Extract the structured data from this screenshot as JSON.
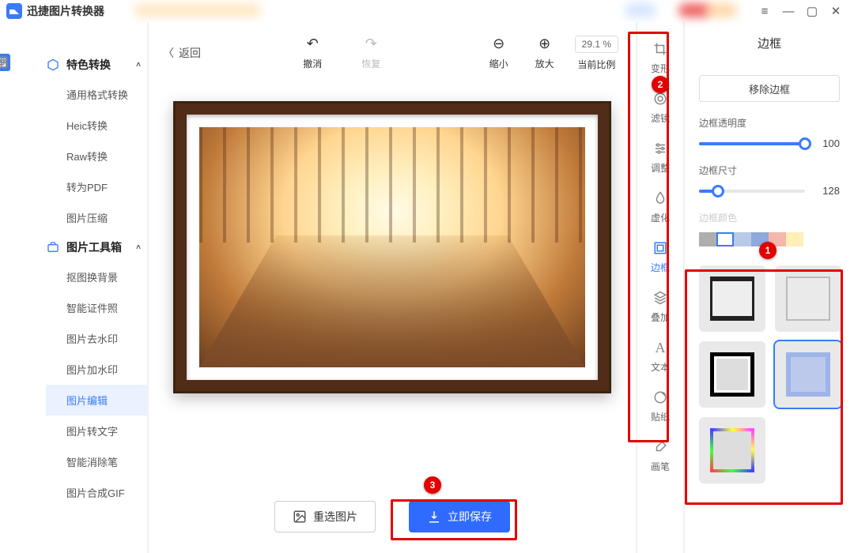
{
  "app": {
    "title": "迅捷图片转换器"
  },
  "window_controls": {
    "menu": "≡",
    "min": "—",
    "max": "▢",
    "close": "✕"
  },
  "minirail": [
    "hex",
    "tiles",
    "image",
    "copy"
  ],
  "sidebar": {
    "group1": {
      "label": "特色转换",
      "items": [
        "通用格式转换",
        "Heic转换",
        "Raw转换",
        "转为PDF",
        "图片压缩"
      ]
    },
    "group2": {
      "label": "图片工具箱",
      "items": [
        "抠图换背景",
        "智能证件照",
        "图片去水印",
        "图片加水印",
        "图片编辑",
        "图片转文字",
        "智能消除笔",
        "图片合成GIF"
      ],
      "active_index": 4
    }
  },
  "topbar": {
    "back": "返回",
    "undo": "撤消",
    "redo": "恢复",
    "zoom_out": "缩小",
    "zoom_in": "放大",
    "ratio": "当前比例",
    "zoom_pct": "29.1 %"
  },
  "bottom": {
    "reselect": "重选图片",
    "save": "立即保存"
  },
  "tool_rail": [
    {
      "key": "transform",
      "label": "变形"
    },
    {
      "key": "filter",
      "label": "滤镜"
    },
    {
      "key": "adjust",
      "label": "调整"
    },
    {
      "key": "blur",
      "label": "虚化"
    },
    {
      "key": "border",
      "label": "边框"
    },
    {
      "key": "overlay",
      "label": "叠加"
    },
    {
      "key": "text",
      "label": "文本"
    },
    {
      "key": "sticker",
      "label": "贴纸"
    },
    {
      "key": "brush",
      "label": "画笔"
    }
  ],
  "tool_rail_active": "border",
  "panel": {
    "title": "边框",
    "remove": "移除边框",
    "opacity_label": "边框透明度",
    "opacity_value": 100,
    "size_label": "边框尺寸",
    "size_value": 128,
    "color_label": "边框颜色",
    "colors": [
      "#aeaeae",
      "#ffffff",
      "#b9c9e7",
      "#8ea9da",
      "#f5b7ac",
      "#fff0b8"
    ],
    "color_selected": 1,
    "frame_selected": 3
  },
  "badges": {
    "b1": "1",
    "b2": "2",
    "b3": "3"
  }
}
